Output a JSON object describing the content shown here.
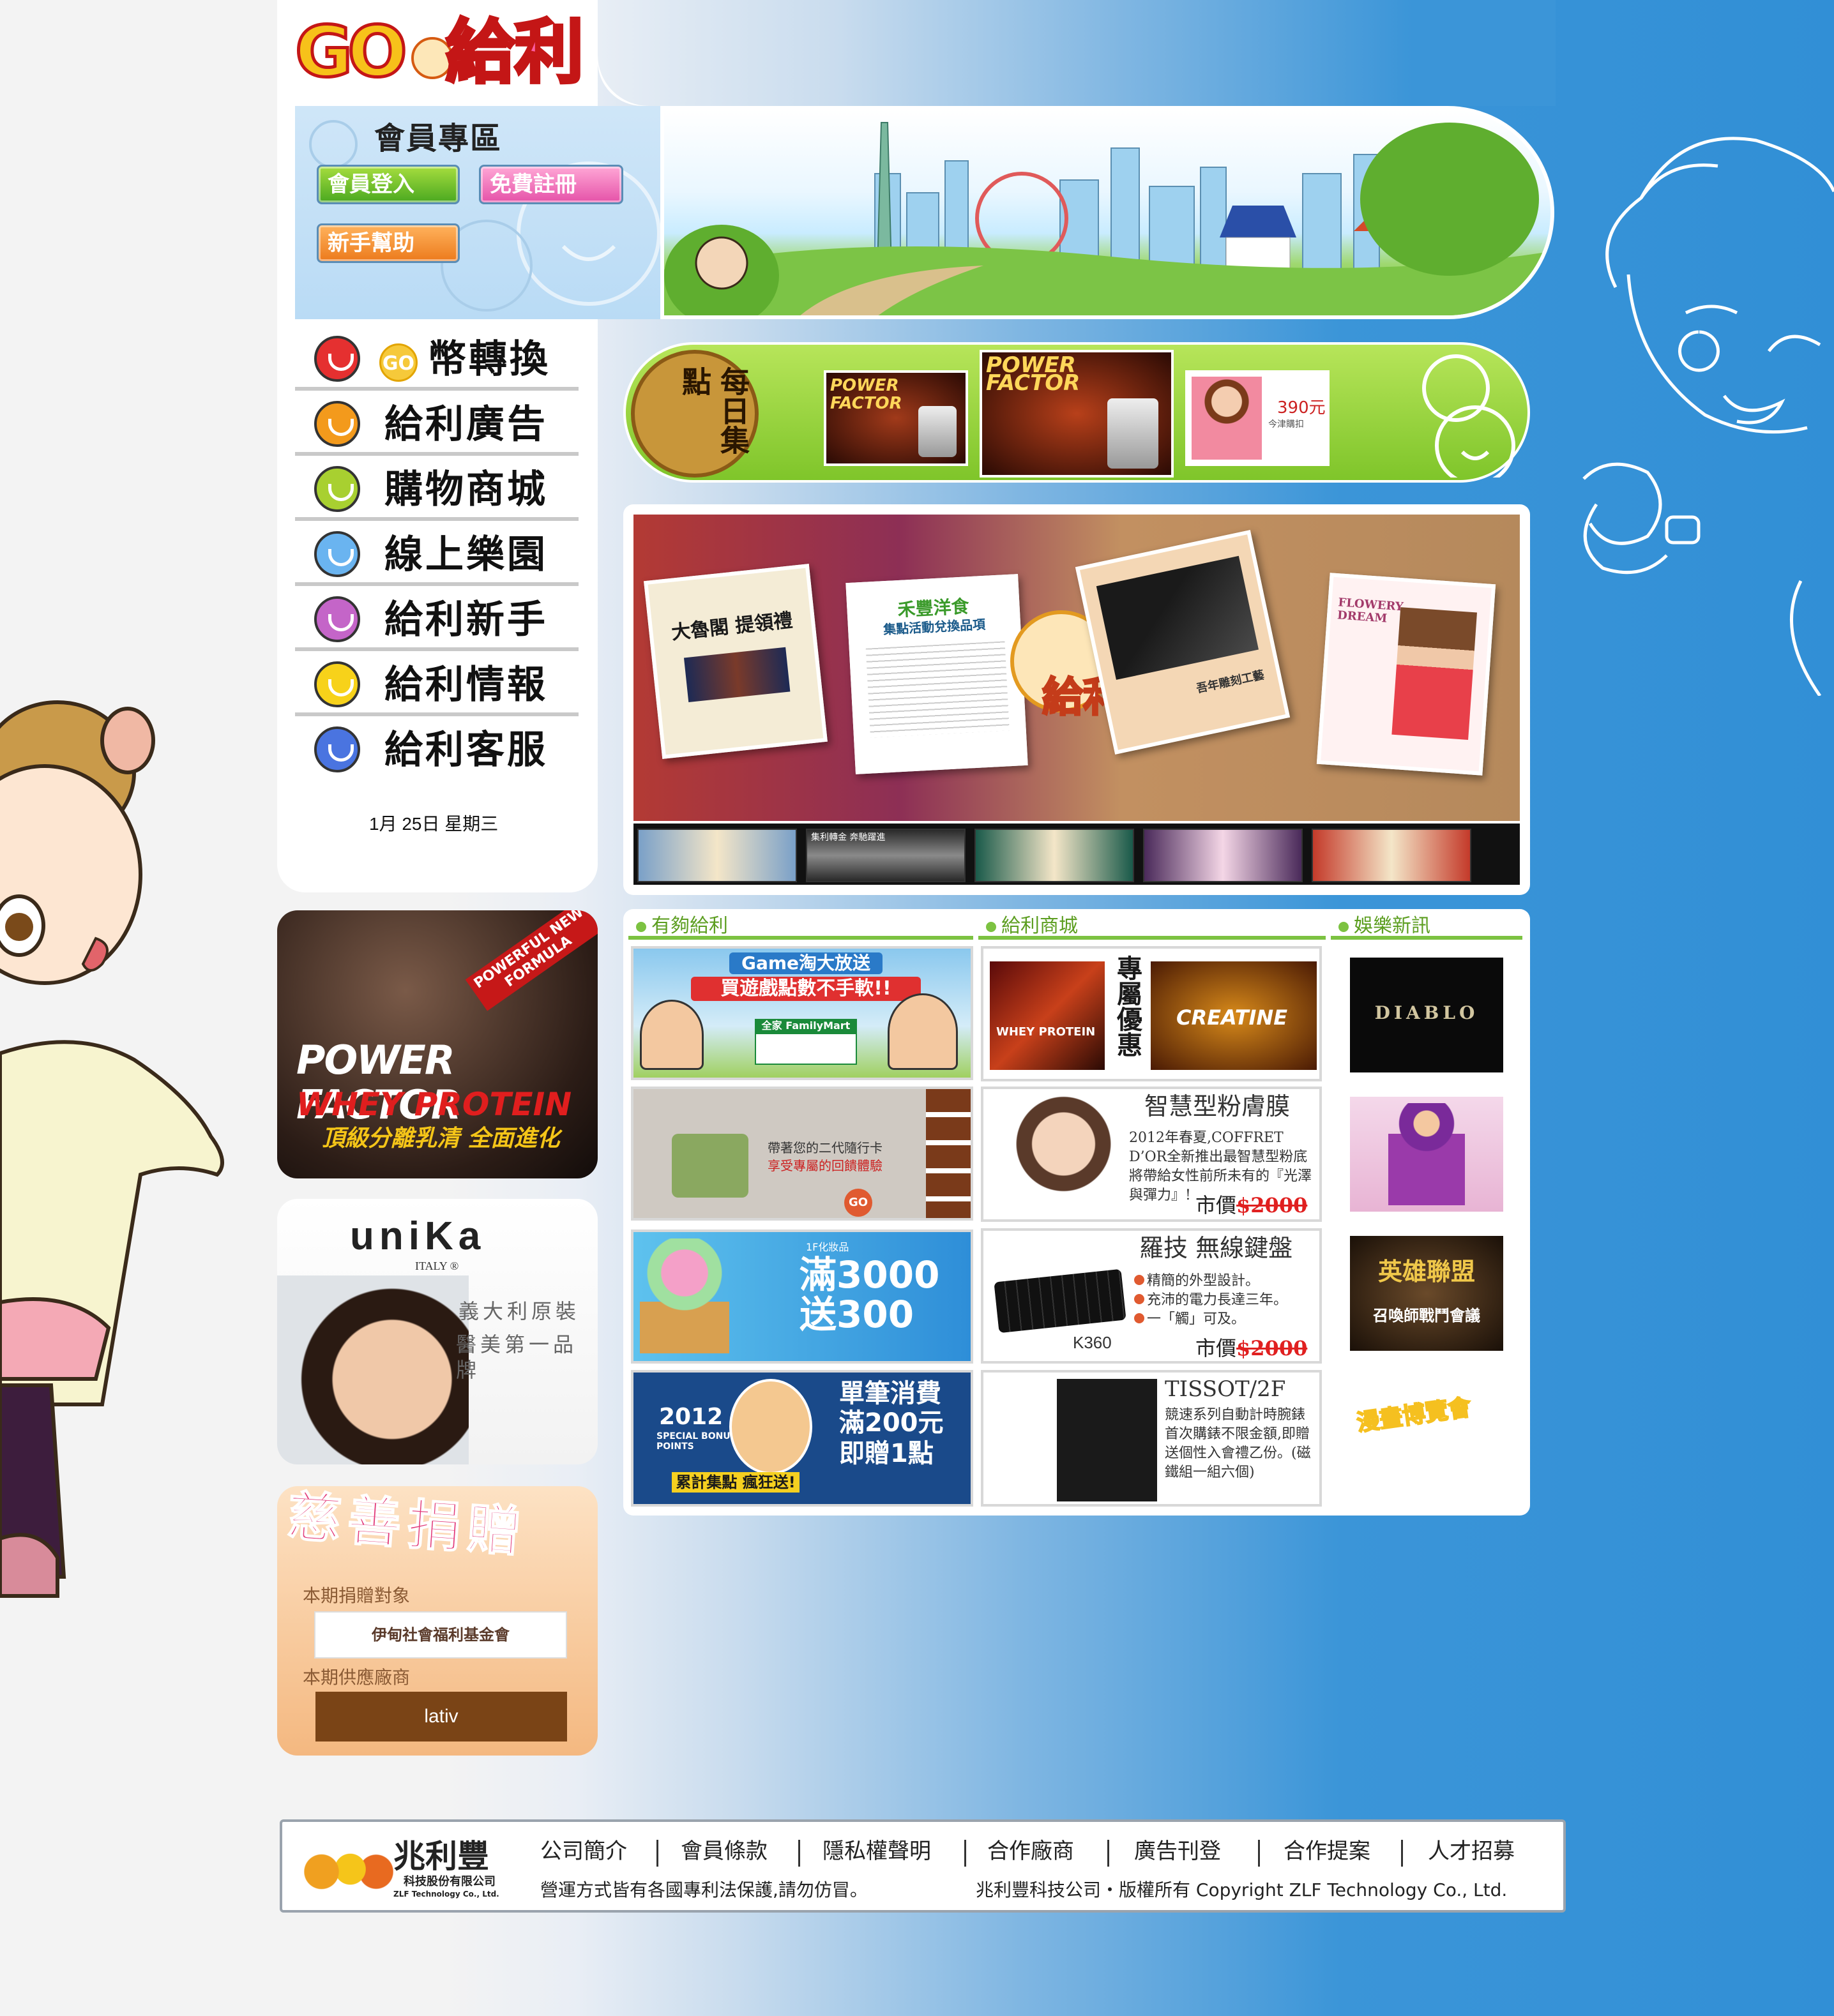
{
  "header": {
    "logo_text_go": "GO",
    "logo_text_main": "給利"
  },
  "member": {
    "title": "會員專區",
    "login_label": "會員登入",
    "register_label": "免費註冊",
    "help_label": "新手幫助"
  },
  "nav": {
    "items": [
      {
        "label": "幣轉換",
        "coin": "GO",
        "color": "#e53030"
      },
      {
        "label": "給利廣告",
        "color": "#f39a1c"
      },
      {
        "label": "購物商城",
        "color": "#a8d030"
      },
      {
        "label": "線上樂園",
        "color": "#6ab4f0"
      },
      {
        "label": "給利新手",
        "color": "#c465c8"
      },
      {
        "label": "給利情報",
        "color": "#f7d21a"
      },
      {
        "label": "給利客服",
        "color": "#4a74e0"
      }
    ],
    "date": "1月 25日 星期三"
  },
  "daily": {
    "medal_label": "每日集點",
    "product1": "POWER FACTOR",
    "product2": "POWER FACTOR",
    "product3_price": "390元",
    "product3_sub": "今津購扣"
  },
  "ads": {
    "powerfactor": {
      "badge": "POWERFUL NEW FORMULA",
      "title": "POWER FACTOR",
      "subtitle": "WHEY PROTEIN",
      "tagline": "頂級分離乳清 全面進化"
    },
    "unika": {
      "brand": "uniKa",
      "origin": "ITALY ®",
      "line1": "義大利原裝",
      "line2": "醫美第一品牌"
    },
    "charity": {
      "title": "慈善捐贈",
      "target_label": "本期捐贈對象",
      "target_name": "伊甸社會福利基金會",
      "supplier_label": "本期供應廠商",
      "supplier_name": "lativ"
    }
  },
  "carousel": {
    "card1_title": "大魯閣 提領禮",
    "card2_title": "禾豐洋食",
    "card2_sub": "集點活動兌換品項",
    "logo_text": "給利",
    "card4_title": "吾年雕刻工藝",
    "card5_title": "FLOWERY DREAM",
    "thumb2_text": "集利轉金 奔馳躍進"
  },
  "columns": {
    "col1_title": "有夠給利",
    "col2_title": "給利商城",
    "col3_title": "娛樂新訊"
  },
  "tiles": {
    "t1_title": "Game淘大放送",
    "t1_sub": "買遊戲點數不手軟!!",
    "t1_store": "全家 FamilyMart",
    "t2_text": "帶著您的二代隨行卡",
    "t2_text2": "享受專屬的回饋體驗",
    "t2_go": "GO",
    "t3_line1": "滿3000",
    "t3_line2": "送300",
    "t3_badge": "1F化妝品",
    "t4_year": "2012",
    "t4_sub": "SPECIAL BONUS POINTS",
    "t4_line1": "單筆消費",
    "t4_line2": "滿200元",
    "t4_line3": "即贈1點",
    "t4_bottom": "累計集點 瘋狂送!"
  },
  "shop": {
    "s1_label": "專屬優惠",
    "s1_title": "WHEY PROTEIN",
    "s1_title2": "CREATINE",
    "s2_title": "智慧型粉膚膜",
    "s2_desc": "2012年春夏,COFFRET D’OR全新推出最智慧型粉底將帶給女性前所未有的『光澤與彈力』!",
    "s2_price_label": "市價",
    "s2_price": "$2000",
    "s3_title": "羅技 無線鍵盤",
    "s3_b1": "精簡的外型設計。",
    "s3_b2": "充沛的電力長達三年。",
    "s3_b3": "一「觸」可及。",
    "s3_model": "K360",
    "s3_price_label": "市價",
    "s3_price": "$2000",
    "s4_title": "TISSOT/2F",
    "s4_desc": "競速系列自動計時腕錶首次購錶不限金額,即贈送個性入會禮乙份。(磁鐵組一組六個)"
  },
  "ent": {
    "e1": "DIABLO",
    "e3_title": "英雄聯盟",
    "e3_sub": "召喚師戰鬥會議",
    "e4_title": "漫畫博覽會"
  },
  "footer": {
    "company_name": "兆利豐",
    "company_full": "科技股份有限公司",
    "company_en": "ZLF Technology Co., Ltd.",
    "links": [
      "公司簡介",
      "會員條款",
      "隱私權聲明",
      "合作廠商",
      "廣告刊登",
      "合作提案",
      "人才招募"
    ],
    "notice": "營運方式皆有各國專利法保護,請勿仿冒。",
    "copyright": "兆利豐科技公司・版權所有  Copyright ZLF Technology Co., Ltd."
  }
}
